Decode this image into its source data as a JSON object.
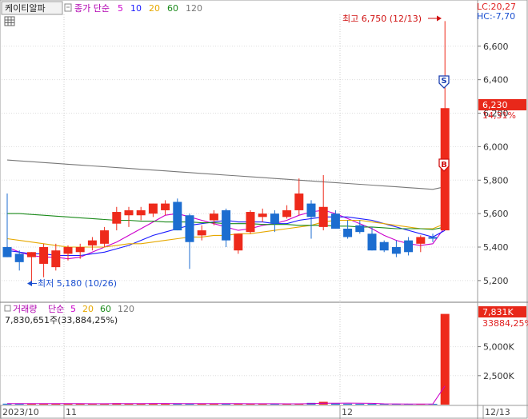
{
  "header": {
    "stock_name": "케이티알파",
    "ma_label": "종가 단순",
    "ma_periods": [
      {
        "label": "5",
        "color": "#cc00cc"
      },
      {
        "label": "10",
        "color": "#1a1aff"
      },
      {
        "label": "20",
        "color": "#e6a800"
      },
      {
        "label": "60",
        "color": "#1a8a1a"
      },
      {
        "label": "120",
        "color": "#777777"
      }
    ],
    "lc_label": "LC:20,27",
    "hc_label": "HC:-7,70"
  },
  "volume_header": {
    "title": "거래량",
    "ma_label": "단순",
    "ma_periods": [
      {
        "label": "5",
        "color": "#cc00cc"
      },
      {
        "label": "20",
        "color": "#e6a800"
      },
      {
        "label": "60",
        "color": "#1a8a1a"
      },
      {
        "label": "120",
        "color": "#777777"
      }
    ],
    "detail": "7,830,651주(33,884,25%)"
  },
  "annotations": {
    "high": "최고 6,750 (12/13)",
    "low": "최저 5,180 (10/26)",
    "sell_marker": "S",
    "buy_marker": "B"
  },
  "price_badge": {
    "value": "6,230",
    "change": "14,31%"
  },
  "volume_badge": {
    "value": "7,831K",
    "change": "33884,25%"
  },
  "colors": {
    "up": "#ee2a1b",
    "down": "#1c6dd0",
    "grid": "#dddddd",
    "badge": "#e8281a"
  },
  "chart_data": [
    {
      "type": "candlestick",
      "title": "케이티알파",
      "price_axis": {
        "ticks": [
          5200,
          5400,
          5600,
          5800,
          6000,
          6200,
          6400,
          6600
        ],
        "tick_labels": [
          "5,200",
          "5,400",
          "5,600",
          "5,800",
          "6,000",
          "6,200",
          "6,400",
          "6,600"
        ],
        "ylim": [
          5080,
          6790
        ]
      },
      "x_axis": {
        "labels": [
          "2023/10",
          "11",
          "12",
          "12/13"
        ]
      },
      "candles": [
        {
          "o": 5400,
          "h": 5720,
          "l": 5340,
          "c": 5340
        },
        {
          "o": 5360,
          "h": 5380,
          "l": 5260,
          "c": 5310
        },
        {
          "o": 5340,
          "h": 5370,
          "l": 5180,
          "c": 5370
        },
        {
          "o": 5300,
          "h": 5420,
          "l": 5220,
          "c": 5400
        },
        {
          "o": 5280,
          "h": 5420,
          "l": 5260,
          "c": 5380
        },
        {
          "o": 5360,
          "h": 5410,
          "l": 5320,
          "c": 5400
        },
        {
          "o": 5370,
          "h": 5420,
          "l": 5330,
          "c": 5400
        },
        {
          "o": 5410,
          "h": 5460,
          "l": 5380,
          "c": 5440
        },
        {
          "o": 5420,
          "h": 5520,
          "l": 5400,
          "c": 5500
        },
        {
          "o": 5540,
          "h": 5640,
          "l": 5500,
          "c": 5610
        },
        {
          "o": 5590,
          "h": 5640,
          "l": 5520,
          "c": 5620
        },
        {
          "o": 5590,
          "h": 5640,
          "l": 5560,
          "c": 5620
        },
        {
          "o": 5600,
          "h": 5660,
          "l": 5580,
          "c": 5660
        },
        {
          "o": 5620,
          "h": 5680,
          "l": 5590,
          "c": 5660
        },
        {
          "o": 5670,
          "h": 5690,
          "l": 5500,
          "c": 5500
        },
        {
          "o": 5590,
          "h": 5600,
          "l": 5270,
          "c": 5430
        },
        {
          "o": 5470,
          "h": 5530,
          "l": 5440,
          "c": 5500
        },
        {
          "o": 5560,
          "h": 5620,
          "l": 5530,
          "c": 5600
        },
        {
          "o": 5620,
          "h": 5630,
          "l": 5400,
          "c": 5440
        },
        {
          "o": 5380,
          "h": 5470,
          "l": 5360,
          "c": 5480
        },
        {
          "o": 5490,
          "h": 5620,
          "l": 5480,
          "c": 5610
        },
        {
          "o": 5580,
          "h": 5630,
          "l": 5550,
          "c": 5600
        },
        {
          "o": 5600,
          "h": 5620,
          "l": 5490,
          "c": 5540
        },
        {
          "o": 5580,
          "h": 5650,
          "l": 5570,
          "c": 5620
        },
        {
          "o": 5620,
          "h": 5810,
          "l": 5590,
          "c": 5720
        },
        {
          "o": 5660,
          "h": 5680,
          "l": 5450,
          "c": 5580
        },
        {
          "o": 5520,
          "h": 5830,
          "l": 5500,
          "c": 5640
        },
        {
          "o": 5600,
          "h": 5620,
          "l": 5510,
          "c": 5510
        },
        {
          "o": 5510,
          "h": 5560,
          "l": 5450,
          "c": 5460
        },
        {
          "o": 5530,
          "h": 5560,
          "l": 5480,
          "c": 5490
        },
        {
          "o": 5480,
          "h": 5520,
          "l": 5380,
          "c": 5380
        },
        {
          "o": 5430,
          "h": 5440,
          "l": 5370,
          "c": 5380
        },
        {
          "o": 5400,
          "h": 5440,
          "l": 5340,
          "c": 5360
        },
        {
          "o": 5440,
          "h": 5460,
          "l": 5350,
          "c": 5370
        },
        {
          "o": 5420,
          "h": 5470,
          "l": 5370,
          "c": 5460
        },
        {
          "o": 5460,
          "h": 5480,
          "l": 5430,
          "c": 5450
        },
        {
          "o": 5500,
          "h": 6750,
          "l": 5500,
          "c": 6230
        }
      ],
      "moving_averages": [
        {
          "period": "5",
          "color": "#cc00cc",
          "values": [
            5400,
            5370,
            5350,
            5340,
            5340,
            5330,
            5340,
            5370,
            5400,
            5430,
            5470,
            5510,
            5550,
            5590,
            5600,
            5580,
            5560,
            5540,
            5520,
            5500,
            5510,
            5530,
            5540,
            5560,
            5590,
            5610,
            5620,
            5600,
            5570,
            5540,
            5510,
            5470,
            5440,
            5420,
            5410,
            5420,
            5520
          ]
        },
        {
          "period": "10",
          "color": "#1a1aff",
          "values": [
            5380,
            5370,
            5360,
            5360,
            5350,
            5350,
            5350,
            5360,
            5370,
            5390,
            5410,
            5440,
            5470,
            5490,
            5510,
            5530,
            5540,
            5550,
            5560,
            5550,
            5550,
            5550,
            5540,
            5540,
            5560,
            5570,
            5580,
            5580,
            5580,
            5570,
            5560,
            5540,
            5520,
            5500,
            5480,
            5460,
            5500
          ]
        },
        {
          "period": "20",
          "color": "#e6a800",
          "values": [
            5450,
            5440,
            5430,
            5420,
            5410,
            5400,
            5400,
            5400,
            5400,
            5410,
            5420,
            5420,
            5430,
            5440,
            5450,
            5460,
            5460,
            5470,
            5470,
            5480,
            5480,
            5490,
            5500,
            5510,
            5520,
            5530,
            5550,
            5560,
            5560,
            5560,
            5550,
            5540,
            5530,
            5520,
            5510,
            5510,
            5540
          ]
        },
        {
          "period": "60",
          "color": "#1a8a1a",
          "values": [
            5600,
            5600,
            5595,
            5590,
            5585,
            5580,
            5575,
            5570,
            5565,
            5560,
            5560,
            5555,
            5555,
            5550,
            5550,
            5550,
            5545,
            5545,
            5540,
            5540,
            5540,
            5535,
            5535,
            5535,
            5530,
            5530,
            5530,
            5525,
            5525,
            5520,
            5520,
            5515,
            5510,
            5510,
            5510,
            5505,
            5520
          ]
        },
        {
          "period": "120",
          "color": "#777777",
          "values": [
            5920,
            5915,
            5910,
            5905,
            5900,
            5895,
            5890,
            5885,
            5880,
            5875,
            5870,
            5865,
            5860,
            5855,
            5850,
            5845,
            5840,
            5835,
            5830,
            5825,
            5820,
            5815,
            5810,
            5805,
            5800,
            5795,
            5790,
            5785,
            5780,
            5775,
            5770,
            5765,
            5760,
            5755,
            5750,
            5745,
            5760
          ]
        }
      ]
    },
    {
      "type": "bar",
      "title": "거래량",
      "volume_axis": {
        "ticks": [
          2500,
          5000
        ],
        "tick_labels": [
          "2,500K",
          "5,000K"
        ],
        "ylim": [
          0,
          8700
        ]
      },
      "values": [
        80,
        90,
        100,
        70,
        60,
        90,
        80,
        70,
        90,
        120,
        100,
        80,
        90,
        80,
        110,
        100,
        70,
        80,
        90,
        70,
        80,
        70,
        60,
        70,
        80,
        150,
        240,
        90,
        80,
        70,
        60,
        60,
        50,
        50,
        60,
        50,
        7831
      ],
      "up": [
        false,
        false,
        true,
        true,
        true,
        true,
        true,
        true,
        true,
        true,
        true,
        true,
        true,
        true,
        false,
        false,
        true,
        true,
        false,
        true,
        true,
        true,
        false,
        true,
        true,
        false,
        true,
        false,
        false,
        false,
        false,
        false,
        false,
        false,
        true,
        false,
        true
      ]
    }
  ]
}
